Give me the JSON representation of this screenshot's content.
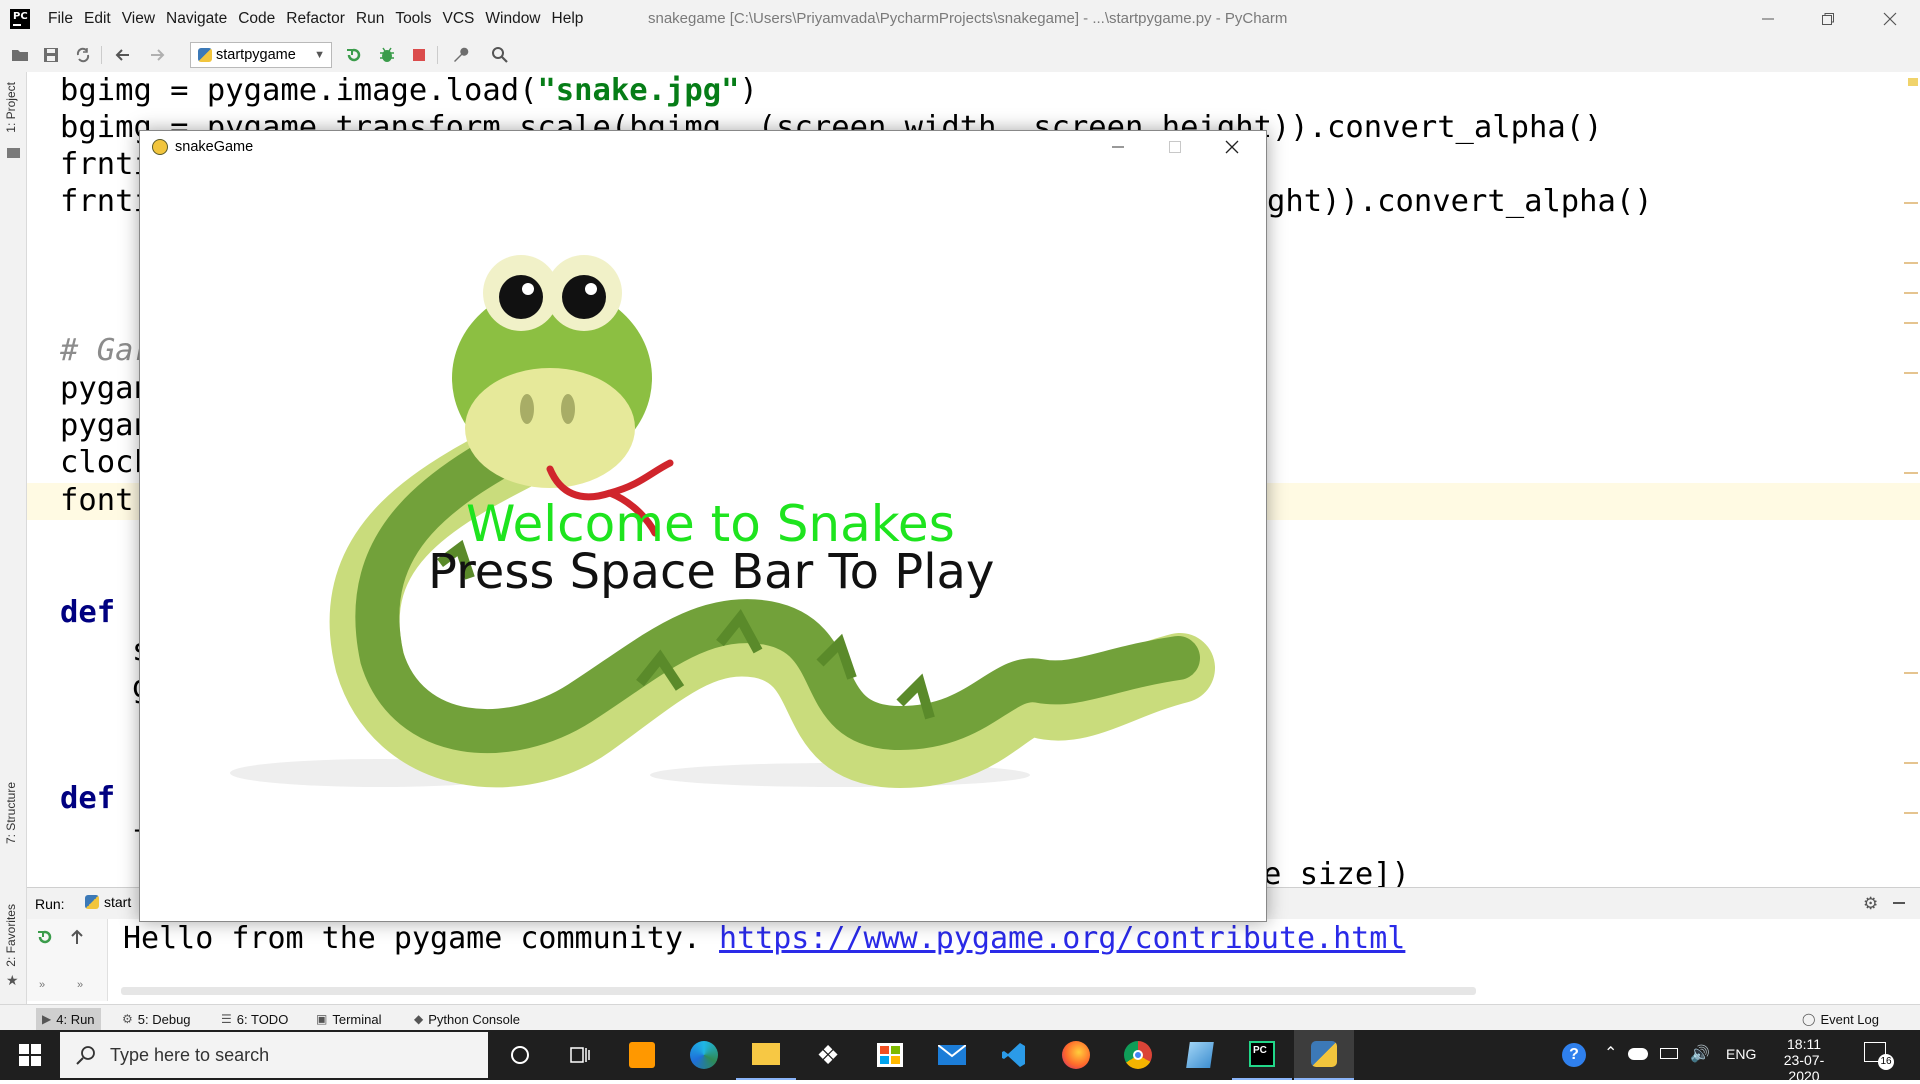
{
  "menubar": {
    "items": [
      "File",
      "Edit",
      "View",
      "Navigate",
      "Code",
      "Refactor",
      "Run",
      "Tools",
      "VCS",
      "Window",
      "Help"
    ],
    "window_title": "snakegame [C:\\Users\\Priyamvada\\PycharmProjects\\snakegame] - ...\\startpygame.py - PyCharm"
  },
  "toolbar": {
    "run_config": "startpygame",
    "icons": [
      "open-folder-icon",
      "save-icon",
      "sync-icon",
      "back-arrow-icon",
      "forward-arrow-icon",
      "rerun-icon",
      "debug-icon",
      "stop-icon",
      "wrench-icon",
      "search-icon"
    ]
  },
  "left_stripe": {
    "project": "1: Project",
    "structure": "7: Structure",
    "favorites": "2: Favorites"
  },
  "editor": {
    "lines": {
      "l1a": "bgimg = pygame.image.load(",
      "l1b": "\"snake.jpg\"",
      "l1c": ")",
      "l2": "bgimg = pygame.transform.scale(bgimg, (screen_width, screen_height)).convert_alpha()",
      "l3": "frnti",
      "l4a": "frnti",
      "l4b": "ght)).convert_alpha()",
      "l5": "# Gar",
      "l6": "pygan",
      "l7": "pygan",
      "l8": "clock",
      "l9": "font",
      "l10": "def",
      "l11": "s",
      "l12": "g",
      "l13": "def",
      "l14": "f",
      "l15": "e size])"
    }
  },
  "run_panel": {
    "label": "Run:",
    "tab": "start",
    "console_text": "Hello from the pygame community. ",
    "console_link": "https://www.pygame.org/contribute.html"
  },
  "bottom_tools": {
    "run": "4: Run",
    "debug": "5: Debug",
    "todo": "6: TODO",
    "terminal": "Terminal",
    "python_console": "Python Console",
    "event_log": "Event Log"
  },
  "pygame_window": {
    "title": "snakeGame",
    "welcome": "Welcome to Snakes",
    "press": "Press Space Bar To Play"
  },
  "taskbar": {
    "search_placeholder": "Type here to search",
    "language": "ENG",
    "time": "18:11",
    "date": "23-07-2020",
    "notifications": "16",
    "apps": [
      "task-view-icon",
      "sublime-text-icon",
      "edge-icon",
      "file-explorer-icon",
      "dropbox-icon",
      "store-icon",
      "mail-icon",
      "vscode-icon",
      "firefox-icon",
      "chrome-icon",
      "notepad-icon",
      "pycharm-icon",
      "python-icon"
    ]
  },
  "colors": {
    "accent_green": "#1ee41e",
    "keyword": "#000080",
    "string": "#067d17",
    "link": "#2a2ae8"
  }
}
